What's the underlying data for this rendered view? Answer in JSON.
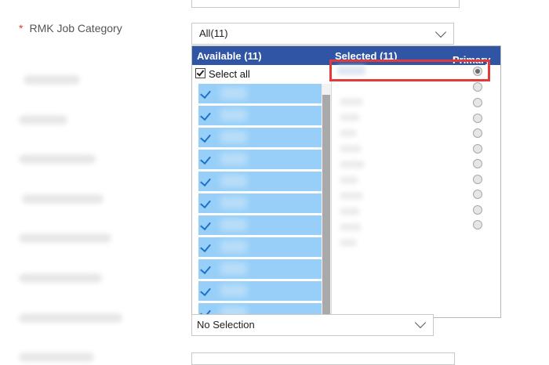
{
  "top_field": {
    "value": ""
  },
  "job_category": {
    "required_mark": "*",
    "label": "RMK Job Category",
    "value": "All(11)"
  },
  "dropdown": {
    "available_header": "Available (11)",
    "selected_header": "Selected (11)",
    "primary_required_mark": "*",
    "primary_header": "Primary",
    "select_all_label": "Select all",
    "available_row_count": 11,
    "primary_selected_index": 0
  },
  "next_select": {
    "value": "No Selection"
  },
  "colors": {
    "header_bg": "#2f55a4",
    "row_bg": "#97cff8",
    "required": "#e0402e",
    "highlight": "#e23a3a"
  }
}
